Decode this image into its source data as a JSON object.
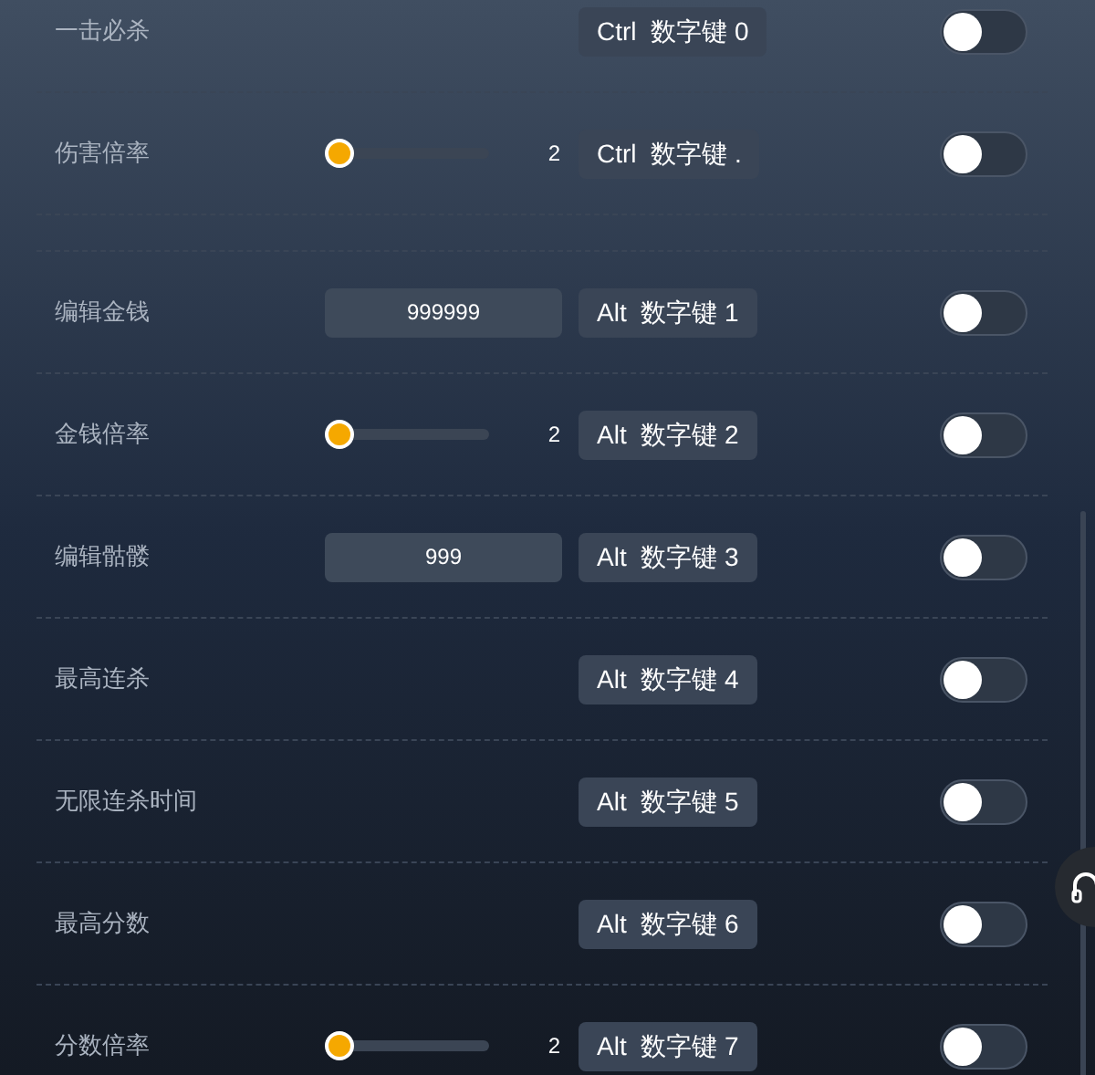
{
  "rows": [
    {
      "kind": "plain",
      "label": "一击必杀",
      "modifier": "Ctrl",
      "key": "数字键 0",
      "on": false
    },
    {
      "kind": "slider",
      "label": "伤害倍率",
      "level": 0,
      "reading": "2",
      "modifier": "Ctrl",
      "key": "数字键 .",
      "on": false
    },
    {
      "kind": "spacer"
    },
    {
      "kind": "input",
      "label": "编辑金钱",
      "value": "999999",
      "modifier": "Alt",
      "key": "数字键 1",
      "on": false
    },
    {
      "kind": "slider",
      "label": "金钱倍率",
      "level": 0,
      "reading": "2",
      "modifier": "Alt",
      "key": "数字键 2",
      "on": false
    },
    {
      "kind": "input",
      "label": "编辑骷髅",
      "value": "999",
      "modifier": "Alt",
      "key": "数字键 3",
      "on": false
    },
    {
      "kind": "plain",
      "label": "最高连杀",
      "modifier": "Alt",
      "key": "数字键 4",
      "on": false
    },
    {
      "kind": "plain",
      "label": "无限连杀时间",
      "modifier": "Alt",
      "key": "数字键 5",
      "on": false
    },
    {
      "kind": "plain",
      "label": "最高分数",
      "modifier": "Alt",
      "key": "数字键 6",
      "on": false
    },
    {
      "kind": "slider",
      "label": "分数倍率",
      "level": 0,
      "reading": "2",
      "modifier": "Alt",
      "key": "数字键 7",
      "on": false
    }
  ]
}
